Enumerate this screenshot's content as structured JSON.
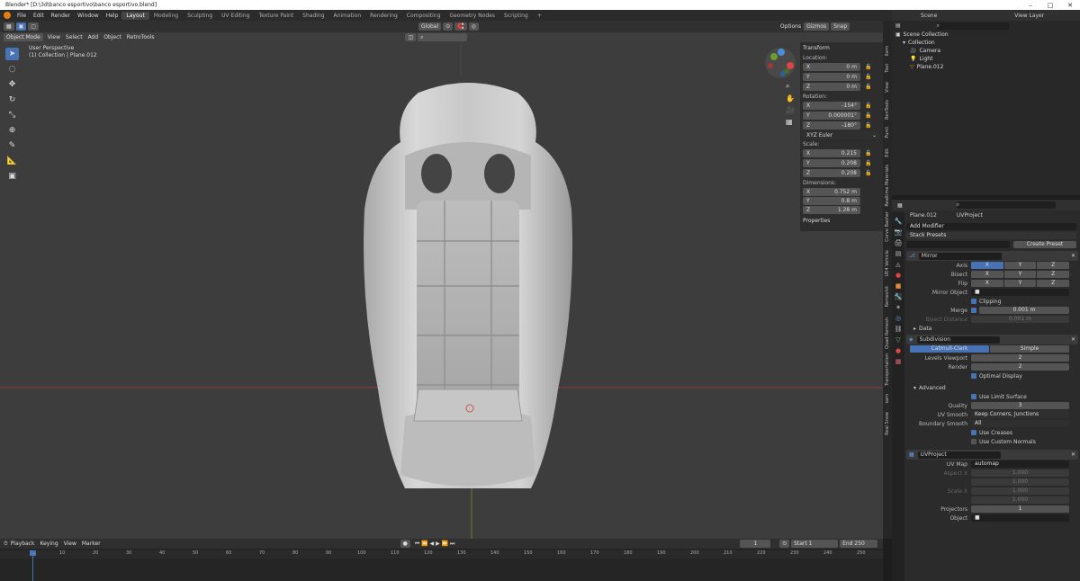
{
  "window": {
    "title": "Blender* [D:\\3d\\banco esportivo\\banco esportivo.blend]",
    "min": "–",
    "max": "□",
    "close": "✕"
  },
  "menu": [
    "File",
    "Edit",
    "Render",
    "Window",
    "Help"
  ],
  "workspaces": [
    "Layout",
    "Modeling",
    "Sculpting",
    "UV Editing",
    "Texture Paint",
    "Shading",
    "Animation",
    "Rendering",
    "Compositing",
    "Geometry Nodes",
    "Scripting",
    "+"
  ],
  "viewport": {
    "mode": "Object Mode",
    "menus": [
      "View",
      "Select",
      "Add",
      "Object",
      "RetroTools"
    ],
    "orientation": "Global",
    "options": "Options",
    "gizmo": "Gizmos",
    "snap": "Snap",
    "perspective": "User Perspective",
    "collection_line": "(1) Collection | Plane.012"
  },
  "npanel": {
    "transform": "Transform",
    "location": "Location:",
    "loc": [
      "0 m",
      "0 m",
      "0 m"
    ],
    "rotation": "Rotation:",
    "rot": [
      "-154°",
      "0.000001°",
      "-180°"
    ],
    "euler": "XYZ Euler",
    "scale": "Scale:",
    "scl": [
      "0.215",
      "0.208",
      "0.208"
    ],
    "dimensions": "Dimensions:",
    "dim": [
      "0.752 m",
      "0.8 m",
      "1.28 m"
    ],
    "properties": "Properties",
    "axes": [
      "X",
      "Y",
      "Z"
    ]
  },
  "vtabs": [
    "Item",
    "Tool",
    "View",
    "RenTools",
    "Punti",
    "Edit",
    "Realtime Materials",
    "Curve Basher",
    "UE4 Vehicle",
    "Remeshit",
    "Quad Remesh",
    "Transportation",
    "sam",
    "Real Snow"
  ],
  "outliner": {
    "scene": "Scene",
    "viewlayer": "View Layer",
    "root": "Scene Collection",
    "items": [
      "Collection",
      "Camera",
      "Light",
      "Plane.012"
    ]
  },
  "props": {
    "object": "Plane.012",
    "modname_active": "UVProject",
    "add_modifier": "Add Modifier",
    "stack_presets": "Stack Presets",
    "create_preset": "Create Preset",
    "mirror": {
      "name": "Mirror",
      "axis": "Axis",
      "bisect": "Bisect",
      "flip": "Flip",
      "mirror_object": "Mirror Object",
      "clipping": "Clipping",
      "merge": "Merge",
      "merge_val": "0.001 m",
      "bisect_dist": "Bisect Distance",
      "bisect_val": "0.001 m",
      "data": "Data"
    },
    "subsurf": {
      "name": "Subdivision",
      "catmull": "Catmull-Clark",
      "simple": "Simple",
      "levels_label": "Levels Viewport",
      "levels": "2",
      "render_label": "Render",
      "render": "2",
      "optimal": "Optimal Display",
      "advanced": "Advanced",
      "limit": "Use Limit Surface",
      "quality_label": "Quality",
      "quality": "3",
      "uvsmooth_label": "UV Smooth",
      "uvsmooth": "Keep Corners, Junctions",
      "boundary_label": "Boundary Smooth",
      "boundary": "All",
      "creases": "Use Creases",
      "normals": "Use Custom Normals"
    },
    "uvproject": {
      "name": "UVProject",
      "uvmap_label": "UV Map",
      "uvmap": "automap",
      "aspx_label": "Aspect X",
      "aspx": "1.000",
      "aspy": "1.000",
      "sclx_label": "Scale X",
      "sclx": "1.000",
      "scly": "1.000",
      "proj_label": "Projectors",
      "proj": "1",
      "obj_label": "Object"
    }
  },
  "timeline": {
    "menus": [
      "Playback",
      "Keying",
      "View",
      "Marker"
    ],
    "frame": "1",
    "start_label": "Start",
    "start": "1",
    "end_label": "End",
    "end": "250",
    "ticks": [
      "1",
      "10",
      "20",
      "30",
      "40",
      "50",
      "60",
      "70",
      "80",
      "90",
      "100",
      "110",
      "120",
      "130",
      "140",
      "150",
      "160",
      "170",
      "180",
      "190",
      "200",
      "210",
      "220",
      "230",
      "240",
      "250"
    ]
  },
  "colors": {
    "accent": "#4772b3",
    "bg": "#3d3d3d",
    "orange": "#e87d0d"
  }
}
